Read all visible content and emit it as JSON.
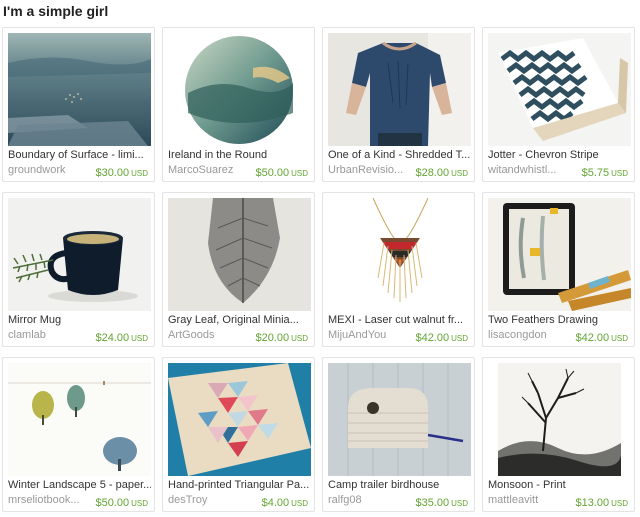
{
  "page": {
    "title": "I'm a simple girl"
  },
  "listings": [
    {
      "title": "Boundary of Surface - limi...",
      "shop": "groundwork",
      "price": "$30.00",
      "currency": "USD"
    },
    {
      "title": "Ireland in the Round",
      "shop": "MarcoSuarez",
      "price": "$50.00",
      "currency": "USD"
    },
    {
      "title": "One of a Kind - Shredded T...",
      "shop": "UrbanRevisio...",
      "price": "$28.00",
      "currency": "USD"
    },
    {
      "title": "Jotter - Chevron Stripe",
      "shop": "witandwhistl...",
      "price": "$5.75",
      "currency": "USD"
    },
    {
      "title": "Mirror Mug",
      "shop": "clamlab",
      "price": "$24.00",
      "currency": "USD"
    },
    {
      "title": "Gray Leaf, Original Minia...",
      "shop": "ArtGoods",
      "price": "$20.00",
      "currency": "USD"
    },
    {
      "title": "MEXI - Laser cut walnut fr...",
      "shop": "MijuAndYou",
      "price": "$42.00",
      "currency": "USD"
    },
    {
      "title": "Two Feathers Drawing",
      "shop": "lisacongdon",
      "price": "$42.00",
      "currency": "USD"
    },
    {
      "title": "Winter Landscape 5 - paper...",
      "shop": "mrseliotbook...",
      "price": "$50.00",
      "currency": "USD"
    },
    {
      "title": "Hand-printed Triangular Pa...",
      "shop": "desTroy",
      "price": "$4.00",
      "currency": "USD"
    },
    {
      "title": "Camp trailer birdhouse",
      "shop": "ralfg08",
      "price": "$35.00",
      "currency": "USD"
    },
    {
      "title": "Monsoon - Print",
      "shop": "mattleavitt",
      "price": "$13.00",
      "currency": "USD"
    }
  ]
}
